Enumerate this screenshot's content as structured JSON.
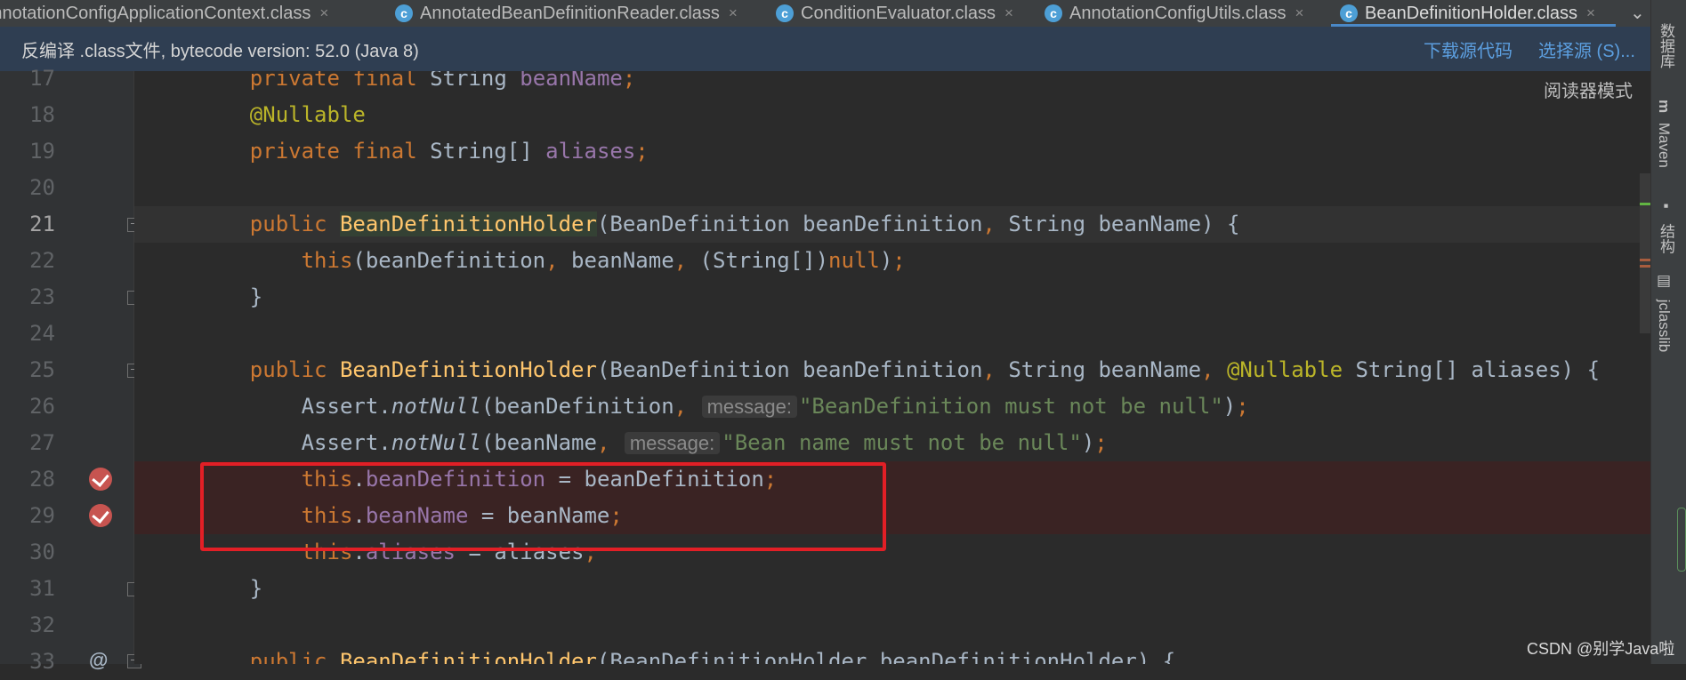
{
  "tabs": [
    {
      "label": "AnnotationConfigApplicationContext.class",
      "icon": "class-file-icon",
      "active": false
    },
    {
      "label": "AnnotatedBeanDefinitionReader.class",
      "icon": "class-file-icon",
      "active": false
    },
    {
      "label": "ConditionEvaluator.class",
      "icon": "class-file-icon",
      "active": false
    },
    {
      "label": "AnnotationConfigUtils.class",
      "icon": "class-file-icon",
      "active": false
    },
    {
      "label": "BeanDefinitionHolder.class",
      "icon": "class-file-icon",
      "active": true
    }
  ],
  "tab_close_glyph": "×",
  "tab_icon_glyph": "c",
  "tab_more_glyph": "⌄",
  "banner": {
    "text": "反编译 .class文件, bytecode version: 52.0 (Java 8)",
    "download_source": "下载源代码",
    "choose_source": "选择源 (S)..."
  },
  "reader_mode": "阅读器模式",
  "line_numbers": [
    "17",
    "18",
    "19",
    "20",
    "21",
    "22",
    "23",
    "24",
    "25",
    "26",
    "27",
    "28",
    "29",
    "30",
    "31",
    "32",
    "33"
  ],
  "current_line": "21",
  "hints": {
    "message": "message:"
  },
  "strings": {
    "bd_not_null": "\"BeanDefinition must not be null\"",
    "bn_not_null": "\"Bean name must not be null\""
  },
  "right_tools": [
    {
      "icon": "database-icon",
      "label": "数据库"
    },
    {
      "icon": "maven-icon",
      "label": "Maven"
    },
    {
      "icon": "structure-icon",
      "label": "结构"
    },
    {
      "icon": "jclasslib-icon",
      "label": "jclasslib"
    }
  ],
  "watermark": "CSDN @别学Java啦",
  "colors": {
    "keyword": "#cc7832",
    "method": "#ffc66d",
    "field": "#9876aa",
    "annotation": "#bbb529",
    "string": "#6a8759",
    "highlight_box": "#e21f26",
    "breakpoint": "#c75450"
  }
}
